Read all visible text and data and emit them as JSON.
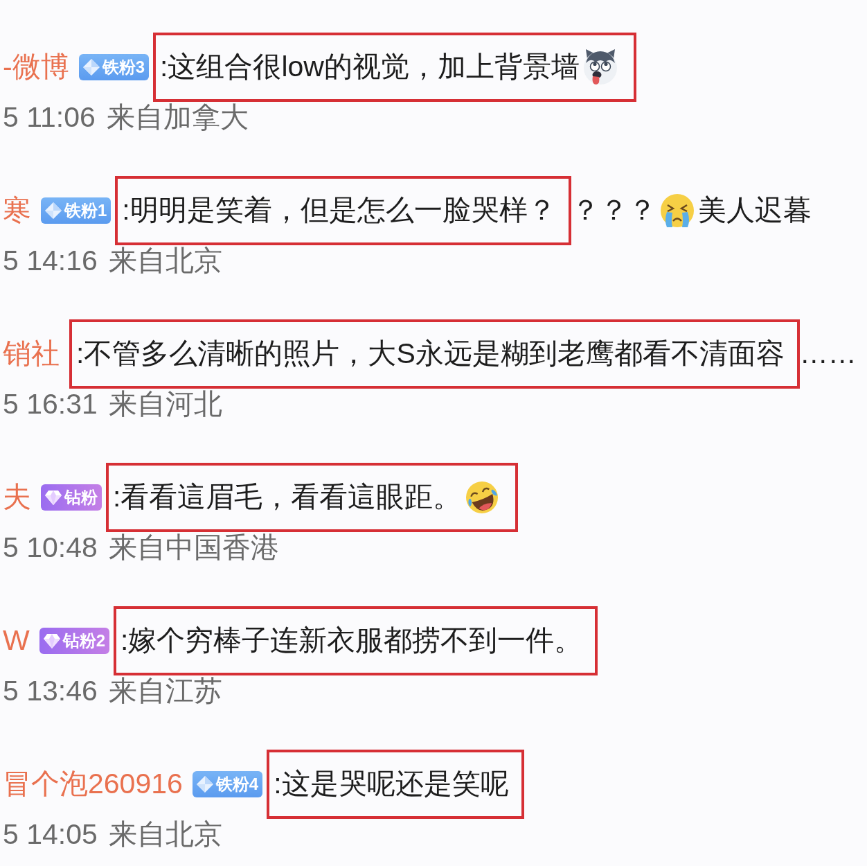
{
  "comments": [
    {
      "username": "-微博",
      "badge": {
        "kind": "iron",
        "text": "铁粉3"
      },
      "segments": [
        {
          "kind": "text",
          "text": ":这组合很low的视觉，加上背景墙",
          "framed": true
        },
        {
          "kind": "dog",
          "framed": true
        }
      ],
      "time": "5 11:06",
      "location": "来自加拿大"
    },
    {
      "username": "寒",
      "badge": {
        "kind": "iron",
        "text": "铁粉1"
      },
      "segments": [
        {
          "kind": "text",
          "text": ":明明是笑着，但是怎么一脸哭样？",
          "framed": true
        },
        {
          "kind": "text",
          "text": "？？？",
          "framed": false
        },
        {
          "kind": "cry",
          "framed": false
        },
        {
          "kind": "text",
          "text": "美人迟暮",
          "framed": false
        }
      ],
      "time": "5 14:16",
      "location": "来自北京"
    },
    {
      "username": "销社",
      "segments": [
        {
          "kind": "text",
          "text": ":不管多么清晰的照片，大S永远是糊到老鹰都看不清面容",
          "framed": true
        },
        {
          "kind": "text",
          "text": "……",
          "framed": false
        }
      ],
      "time": "5 16:31",
      "location": "来自河北"
    },
    {
      "username": "夫",
      "badge": {
        "kind": "diamond",
        "text": "钻粉"
      },
      "segments": [
        {
          "kind": "text",
          "text": ":看看這眉毛，看看這眼距。",
          "framed": true
        },
        {
          "kind": "laughcry",
          "framed": true
        }
      ],
      "time": "5 10:48",
      "location": "来自中国香港"
    },
    {
      "username": "W",
      "badge": {
        "kind": "diamond",
        "text": "钻粉2"
      },
      "segments": [
        {
          "kind": "text",
          "text": ":嫁个穷棒子连新衣服都捞不到一件。",
          "framed": true
        }
      ],
      "time": "5 13:46",
      "location": "来自江苏"
    },
    {
      "username": "冒个泡260916",
      "badge": {
        "kind": "iron",
        "text": "铁粉4"
      },
      "segments": [
        {
          "kind": "text",
          "text": ":这是哭呢还是笑呢",
          "framed": true
        }
      ],
      "time": "5 14:05",
      "location": "来自北京"
    }
  ]
}
